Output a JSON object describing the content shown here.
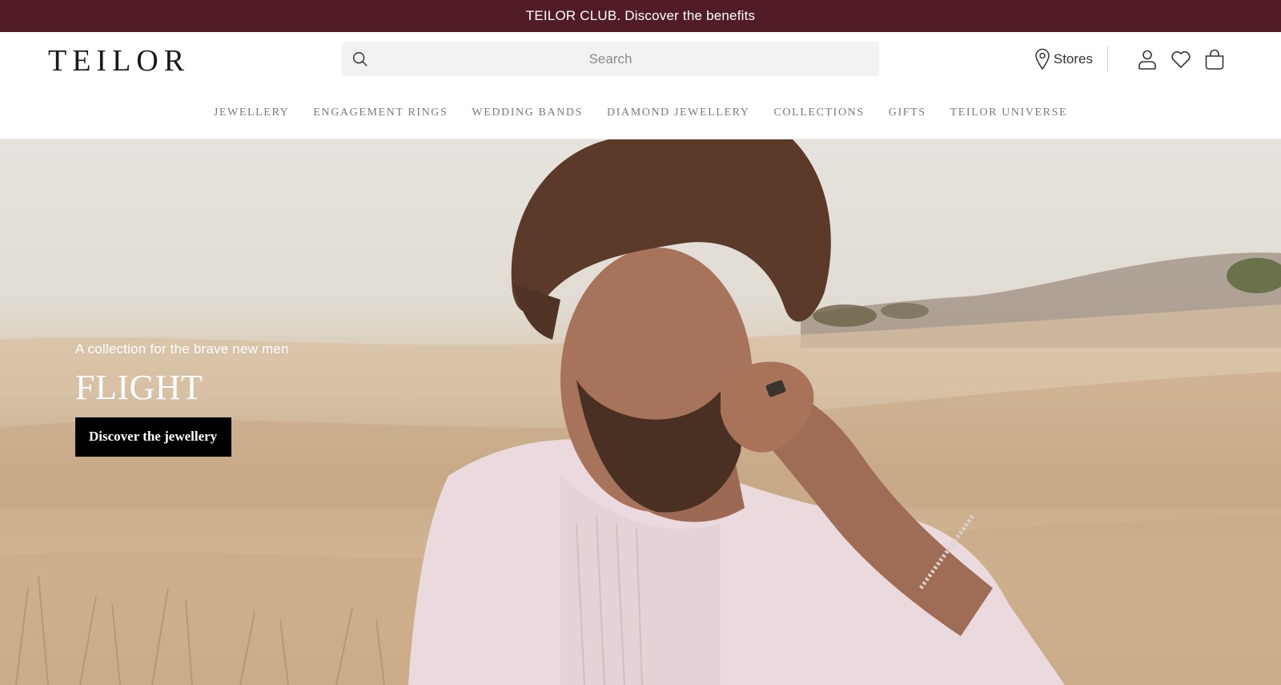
{
  "promo": {
    "text": "TEILOR CLUB. Discover the benefits"
  },
  "header": {
    "logo": "TEILOR",
    "search": {
      "placeholder": "Search"
    },
    "stores_label": "Stores"
  },
  "nav": {
    "items": [
      {
        "label": "JEWELLERY"
      },
      {
        "label": "ENGAGEMENT RINGS"
      },
      {
        "label": "WEDDING BANDS"
      },
      {
        "label": "DIAMOND JEWELLERY"
      },
      {
        "label": "COLLECTIONS"
      },
      {
        "label": "GIFTS"
      },
      {
        "label": "TEILOR UNIVERSE"
      }
    ]
  },
  "hero": {
    "subtitle": "A collection for the brave new men",
    "title": "FLIGHT",
    "cta_label": "Discover the jewellery"
  },
  "icons": {
    "search": "search-icon",
    "stores": "map-pin-icon",
    "account": "user-icon",
    "wishlist": "heart-icon",
    "cart": "shopping-bag-icon"
  },
  "colors": {
    "promo_bg": "#521c27",
    "nav_text": "#7a7a7a",
    "cta_bg": "#000000"
  }
}
